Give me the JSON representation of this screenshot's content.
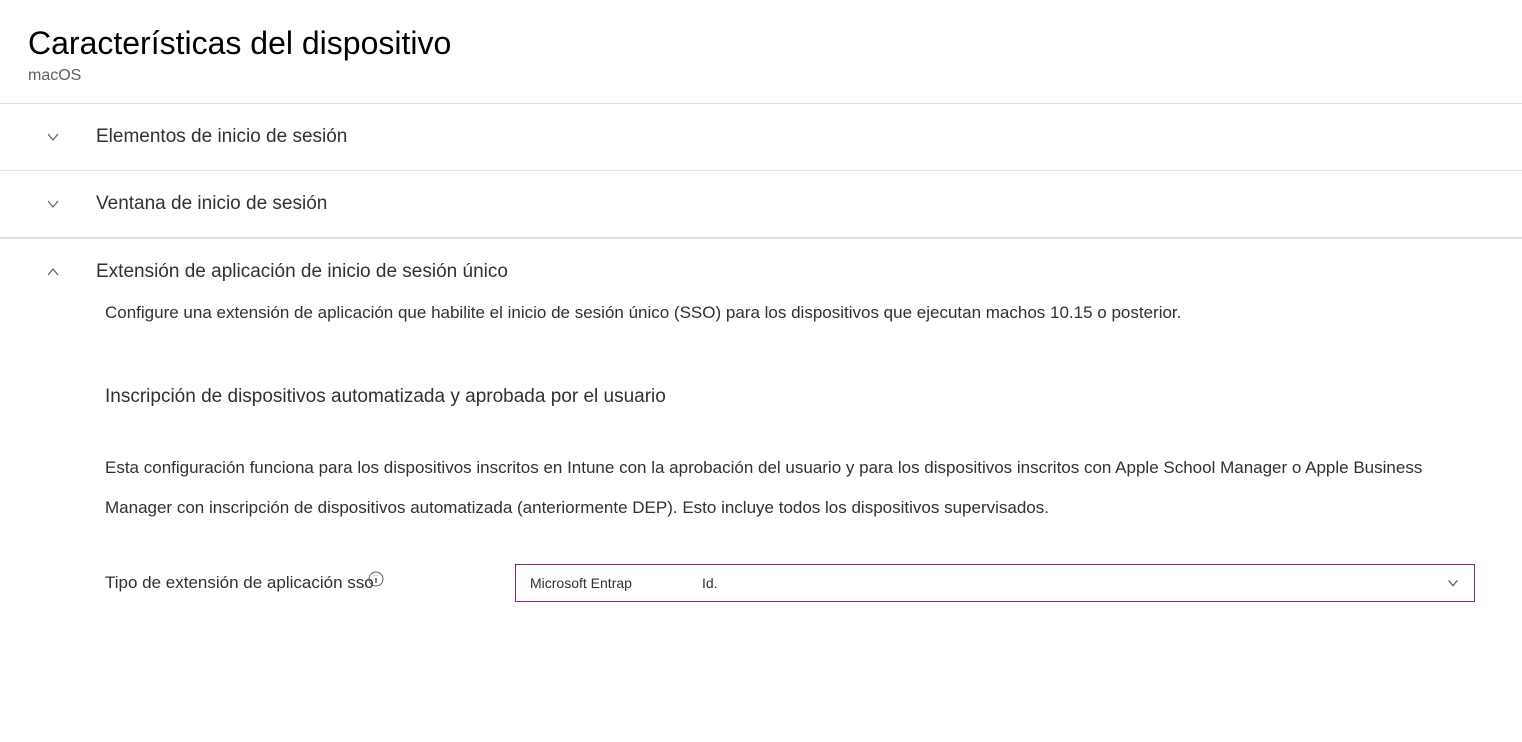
{
  "header": {
    "title": "Características del dispositivo",
    "subtitle": "macOS"
  },
  "sections": {
    "login_items": {
      "title": "Elementos de inicio de sesión"
    },
    "login_window": {
      "title": "Ventana de inicio de sesión"
    },
    "sso_extension": {
      "title": "Extensión de aplicación de inicio de sesión único",
      "description": "Configure una extensión de aplicación que habilite el inicio de sesión único (SSO) para los dispositivos que ejecutan machos 10.15 o posterior.",
      "subsection_heading": "Inscripción de dispositivos automatizada y aprobada por el usuario",
      "subsection_description": "Esta configuración funciona para los dispositivos inscritos en        Intune con la aprobación del usuario y para los dispositivos inscritos con Apple School Manager o Apple Business Manager con inscripción de dispositivos automatizada (anteriormente DEP). Esto incluye todos los dispositivos supervisados.",
      "dropdown": {
        "label": "Tipo de extensión de aplicación sso",
        "value_part1": "Microsoft Entrap",
        "value_part2": "Id."
      }
    }
  }
}
